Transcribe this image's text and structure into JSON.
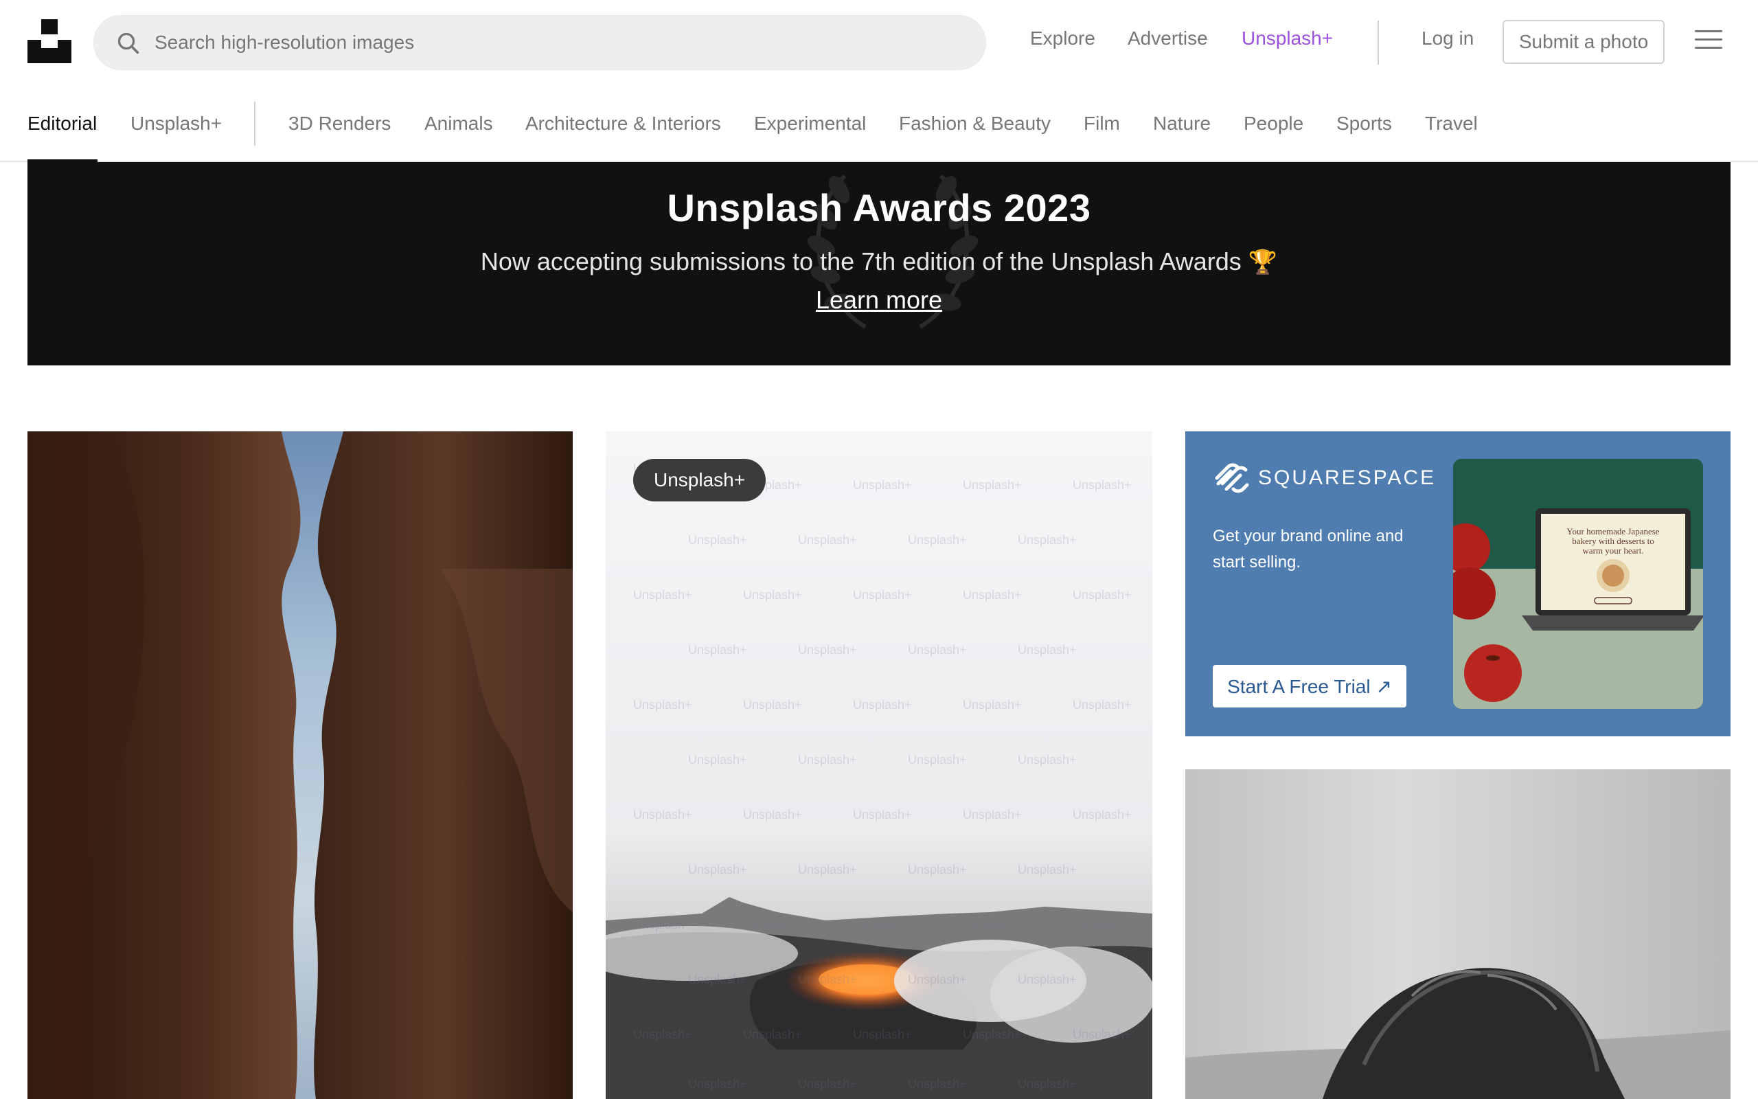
{
  "header": {
    "search_placeholder": "Search high-resolution images",
    "nav": {
      "explore": "Explore",
      "advertise": "Advertise",
      "unsplash_plus": "Unsplash+",
      "login": "Log in",
      "submit": "Submit a photo"
    },
    "colors": {
      "plus_accent": "#9b51e0",
      "muted": "#767676"
    }
  },
  "categories": {
    "items": [
      "Editorial",
      "Unsplash+",
      "3D Renders",
      "Animals",
      "Architecture & Interiors",
      "Experimental",
      "Fashion & Beauty",
      "Film",
      "Nature",
      "People",
      "Sports",
      "Travel"
    ],
    "active": "Editorial"
  },
  "banner": {
    "title": "Unsplash Awards 2023",
    "subtitle": "Now accepting submissions to the 7th edition of the Unsplash Awards",
    "link": "Learn more"
  },
  "grid": {
    "badge": "Unsplash+",
    "watermark": "Unsplash+"
  },
  "ad": {
    "brand": "SQUARESPACE",
    "text": "Get your brand online and start selling.",
    "cta": "Start A Free Trial ↗"
  },
  "icons": {
    "search": "search-icon",
    "menu": "hamburger-menu-icon",
    "logo": "unsplash-logo-icon",
    "trophy": "trophy-icon"
  }
}
